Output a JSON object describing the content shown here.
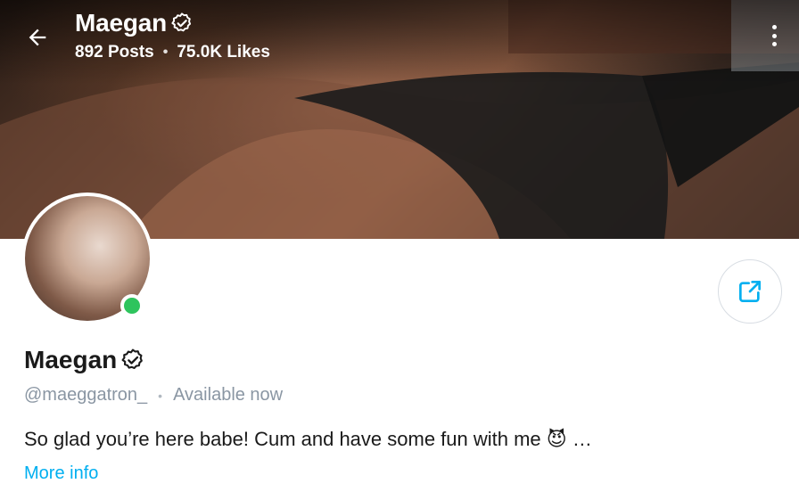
{
  "header": {
    "title": "Maegan",
    "posts": "892 Posts",
    "likes": "75.0K Likes",
    "separator": "•"
  },
  "profile": {
    "name": "Maegan",
    "handle": "@maeggatron_",
    "separator": "•",
    "status": "Available now",
    "bio": "So glad you’re here babe! Cum and have some fun with me 😈 ",
    "bio_tail": "…",
    "more_info": "More info"
  },
  "icons": {
    "back": "arrow-left-icon",
    "verified": "verified-badge-icon",
    "menu": "more-vertical-icon",
    "share": "share-icon"
  },
  "colors": {
    "accent": "#00aff0",
    "online": "#2ec45d",
    "muted": "#8a96a3",
    "text": "#1a1a1a"
  }
}
